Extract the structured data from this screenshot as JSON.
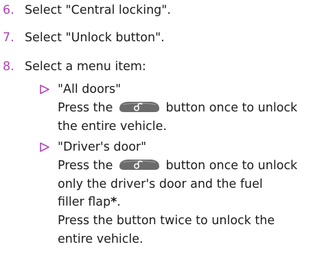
{
  "steps": [
    {
      "num": "6.",
      "text": "Select \"Central locking\"."
    },
    {
      "num": "7.",
      "text": "Select \"Unlock button\"."
    },
    {
      "num": "8.",
      "text": "Select a menu item:"
    }
  ],
  "options": [
    {
      "title": "\"All doors\"",
      "line1_pre": "Press the",
      "line1_post": "button once to unlock",
      "line2": "the entire vehicle."
    },
    {
      "title": "\"Driver's door\"",
      "line1_pre": "Press the",
      "line1_post": "button once to unlock",
      "line2": "only the driver's door and the fuel",
      "line3": "filler flap",
      "star": "*",
      "line3_end": ".",
      "line4": "Press the button twice to unlock the",
      "line5": "entire vehicle."
    }
  ],
  "colors": {
    "step_number": "#b042b8",
    "bullet": "#b042b8",
    "key_button": "#6c6c6c"
  },
  "icons": {
    "bullet": "triangle-bullet-icon",
    "key": "key-unlock-button-icon"
  }
}
